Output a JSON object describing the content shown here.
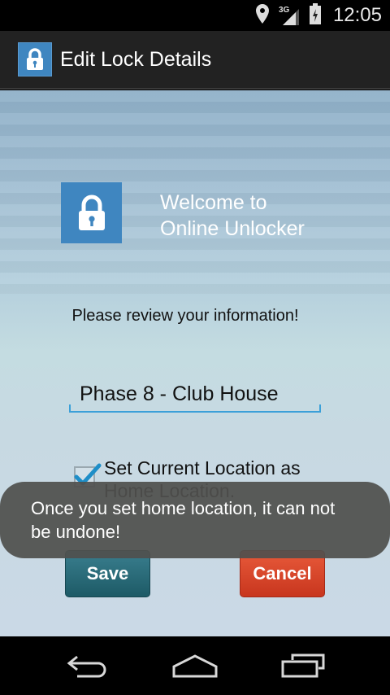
{
  "status_bar": {
    "time": "12:05",
    "network_label": "3G",
    "icons": [
      "location-icon",
      "signal-icon",
      "battery-icon"
    ]
  },
  "action_bar": {
    "title": "Edit Lock Details",
    "icon": "lock-icon"
  },
  "main": {
    "welcome_text": "Welcome to\nOnline Unlocker",
    "review_prompt": "Please review your information!",
    "lock_name_value": "Phase 8 - Club House",
    "checkbox_label": "Set Current Location as\nHome Location.",
    "checkbox_checked": true,
    "save_label": "Save",
    "cancel_label": "Cancel"
  },
  "toast": {
    "message": "Once you set home location, it can not be undone!"
  },
  "nav_bar": {
    "icons": [
      "back-icon",
      "home-icon",
      "recent-apps-icon"
    ]
  },
  "colors": {
    "accent_blue": "#3f86c0",
    "input_underline": "#3ba0d8",
    "save_button": "#2a6e7c",
    "cancel_button": "#d8442a"
  }
}
